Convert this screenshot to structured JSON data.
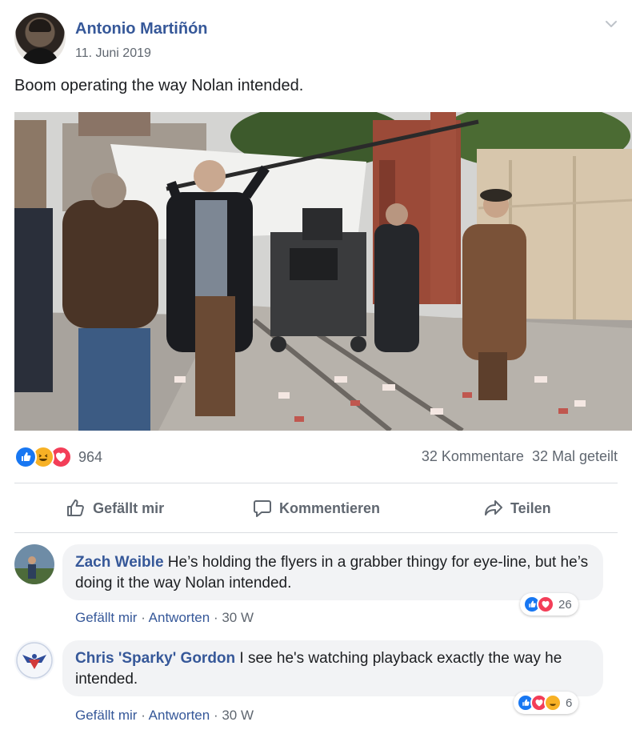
{
  "post": {
    "author": "Antonio Martiñón",
    "date": "11. Juni 2019",
    "text": "Boom operating the way Nolan intended.",
    "photo_icon": "movie-set-photo"
  },
  "reactions": {
    "types": [
      "like",
      "haha",
      "love"
    ],
    "count": "964",
    "comments_count": "32 Kommentare",
    "shares_count": "32 Mal geteilt"
  },
  "actions": {
    "like": "Gefällt mir",
    "comment": "Kommentieren",
    "share": "Teilen"
  },
  "comments": [
    {
      "name": "Zach Weible",
      "text": "He’s holding the flyers in a grabber thingy for eye-line, but he’s doing it the way Nolan intended.",
      "like": "Gefällt mir",
      "reply": "Antworten",
      "age": "30 W",
      "reactions": [
        "like",
        "love"
      ],
      "reaction_count": "26"
    },
    {
      "name": "Chris 'Sparky' Gordon",
      "text": "I see he's watching playback exactly the way he intended.",
      "like": "Gefällt mir",
      "reply": "Antworten",
      "age": "30 W",
      "reactions": [
        "like",
        "love",
        "haha"
      ],
      "reaction_count": "6"
    }
  ],
  "colors": {
    "link": "#365899",
    "like": "#1877f2",
    "haha": "#f7b125",
    "love": "#f33e58",
    "meta": "#606770",
    "bubble": "#f2f3f5"
  }
}
